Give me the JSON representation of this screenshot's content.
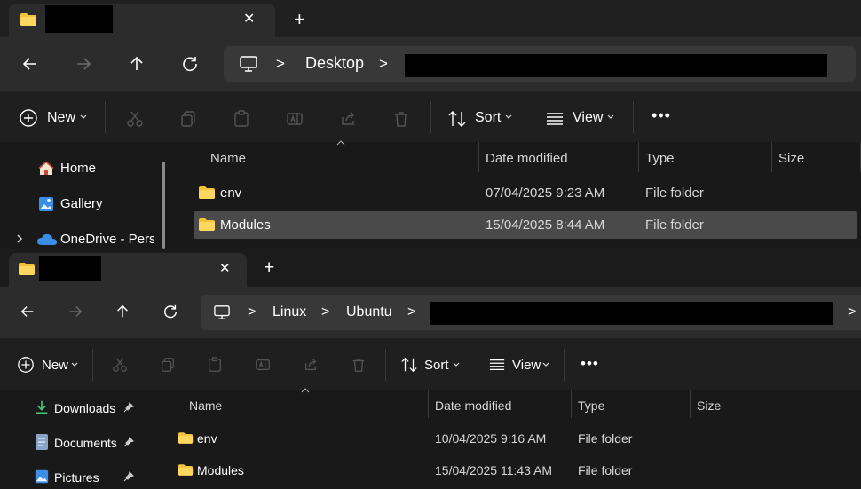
{
  "window1": {
    "tab": {
      "close_glyph": "✕",
      "new_tab_glyph": "+"
    },
    "address": {
      "segment1": "Desktop",
      "separator": ">"
    },
    "toolbar": {
      "new_label": "New",
      "sort_label": "Sort",
      "view_label": "View",
      "more_glyph": "•••"
    },
    "sidebar": {
      "items": [
        {
          "label": "Home"
        },
        {
          "label": "Gallery"
        },
        {
          "label": "OneDrive - Perso"
        }
      ]
    },
    "columns": {
      "name": "Name",
      "date": "Date modified",
      "type": "Type",
      "size": "Size"
    },
    "rows": [
      {
        "name": "env",
        "date": "07/04/2025 9:23 AM",
        "type": "File folder"
      },
      {
        "name": "Modules",
        "date": "15/04/2025 8:44 AM",
        "type": "File folder"
      }
    ]
  },
  "window2": {
    "tab": {
      "close_glyph": "✕",
      "new_tab_glyph": "+"
    },
    "address": {
      "segment1": "Linux",
      "segment2": "Ubuntu",
      "separator": ">"
    },
    "toolbar": {
      "new_label": "New",
      "sort_label": "Sort",
      "view_label": "View",
      "more_glyph": "•••"
    },
    "sidebar": {
      "items": [
        {
          "label": "Downloads"
        },
        {
          "label": "Documents"
        },
        {
          "label": "Pictures"
        }
      ]
    },
    "columns": {
      "name": "Name",
      "date": "Date modified",
      "type": "Type",
      "size": "Size"
    },
    "rows": [
      {
        "name": "env",
        "date": "10/04/2025 9:16 AM",
        "type": "File folder"
      },
      {
        "name": "Modules",
        "date": "15/04/2025 11:43 AM",
        "type": "File folder"
      }
    ]
  },
  "colors": {
    "folder": "#f3c13a",
    "accent": "#4cc2ff",
    "selection": "#4a4a4a"
  }
}
